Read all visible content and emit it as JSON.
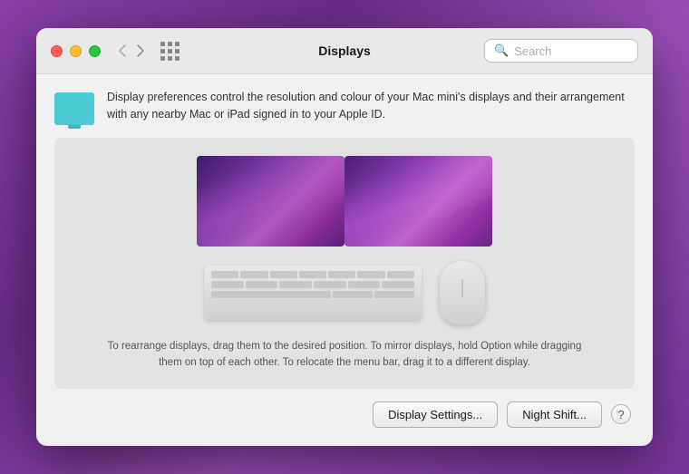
{
  "window": {
    "title": "Displays"
  },
  "titlebar": {
    "traffic_lights": {
      "close": "close",
      "minimize": "minimize",
      "maximize": "maximize"
    },
    "nav_back_label": "‹",
    "nav_forward_label": "›"
  },
  "search": {
    "placeholder": "Search"
  },
  "description": {
    "text": "Display preferences control the resolution and colour of your Mac mini's displays and their arrangement with any nearby Mac or iPad signed in to your Apple ID."
  },
  "helper_text": {
    "line1": "To rearrange displays, drag them to the desired position. To mirror displays, hold Option while dragging",
    "line2": "them on top of each other. To relocate the menu bar, drag it to a different display."
  },
  "buttons": {
    "display_settings": "Display Settings...",
    "night_shift": "Night Shift...",
    "help": "?"
  },
  "colors": {
    "tl_close": "#FF5F57",
    "tl_minimize": "#FEBC2E",
    "tl_maximize": "#28C840"
  }
}
